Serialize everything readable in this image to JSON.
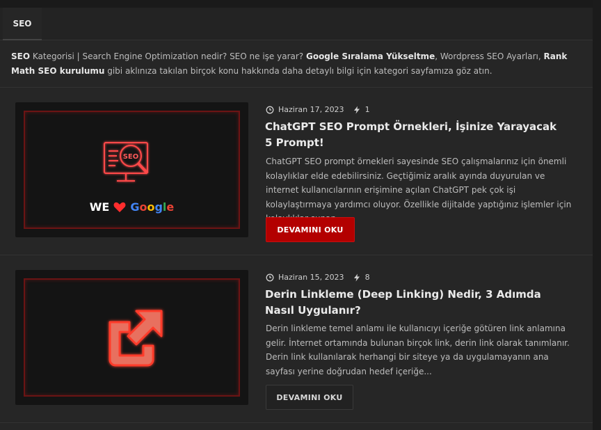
{
  "tab": {
    "label": "SEO"
  },
  "category_desc": {
    "b1": "SEO",
    "t1": " Kategorisi | Search Engine Optimization nedir? SEO ne işe yarar? ",
    "b2": "Google Sıralama Yükseltme",
    "t2": ", Wordpress SEO Ayarları, ",
    "b3": "Rank Math SEO kurulumu",
    "t3": " gibi aklınıza takılan birçok konu hakkında daha detaylı bilgi için kategori sayfamıza göz atın."
  },
  "posts": [
    {
      "date": "Haziran 17, 2023",
      "views": "1",
      "title": "ChatGPT SEO Prompt Örnekleri, İşinize Yarayacak 5 Prompt!",
      "excerpt": "ChatGPT SEO prompt örnekleri sayesinde SEO çalışmalarınız için önemli kolaylıklar elde edebilirsiniz. Geçtiğimiz aralık ayında duyurulan ve internet kullanıcılarının erişimine açılan ChatGPT pek çok işi kolaylaştırmaya yardımcı oluyor. Özellikle dijitalde yaptığınız işlemler için kolaylıklar sunan...",
      "button": "DEVAMINI OKU",
      "thumb": {
        "icon": "seo-monitor-icon",
        "we": "WE",
        "google": "Google"
      }
    },
    {
      "date": "Haziran 15, 2023",
      "views": "8",
      "title": "Derin Linkleme (Deep Linking) Nedir, 3 Adımda Nasıl Uygulanır?",
      "excerpt": "Derin linkleme temel anlamı ile kullanıcıyı içeriğe götüren link anlamına gelir. İnternet ortamında bulunan birçok link, derin link olarak tanımlanır. Derin link kullanılarak herhangi bir siteye ya da uygulamayanın ana sayfası yerine doğrudan hedef içeriğe...",
      "button": "DEVAMINI OKU",
      "thumb": {
        "icon": "external-link-icon"
      }
    }
  ],
  "colors": {
    "accent": "#b30000",
    "bg": "#262626"
  }
}
